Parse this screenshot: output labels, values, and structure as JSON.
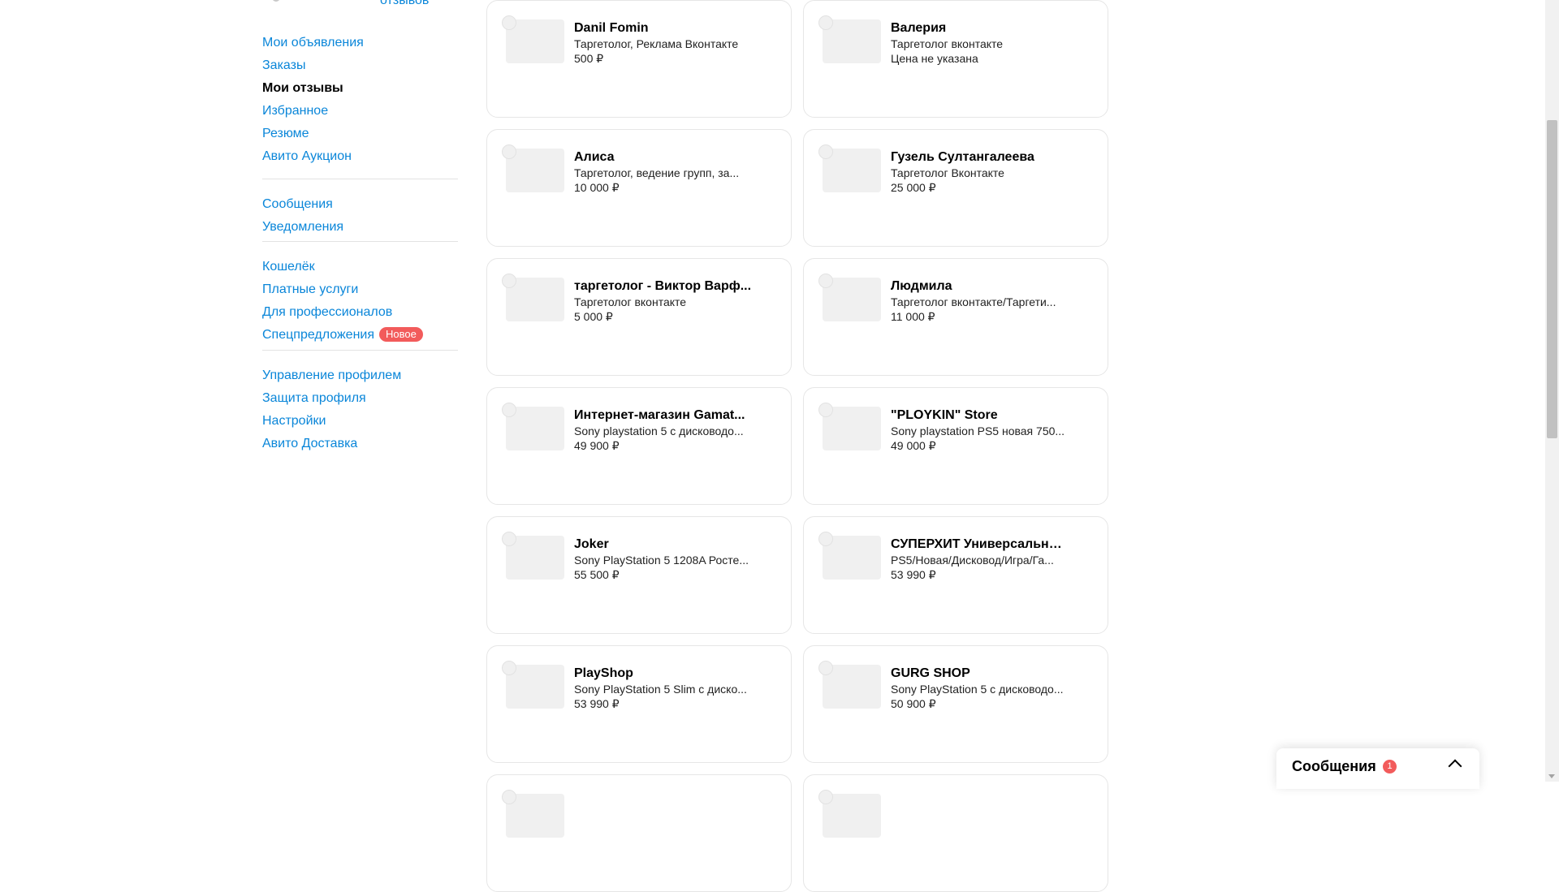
{
  "sidebar": {
    "reviews_link": "отзывов",
    "groups": [
      {
        "items": [
          {
            "label": "Мои объявления",
            "name": "sidebar-item-my-ads"
          },
          {
            "label": "Заказы",
            "name": "sidebar-item-orders"
          },
          {
            "label": "Мои отзывы",
            "name": "sidebar-item-my-reviews",
            "active": true
          },
          {
            "label": "Избранное",
            "name": "sidebar-item-favorites"
          },
          {
            "label": "Резюме",
            "name": "sidebar-item-resume"
          },
          {
            "label": "Авито Аукцион",
            "name": "sidebar-item-auction"
          }
        ]
      },
      {
        "items": [
          {
            "label": "Сообщения",
            "name": "sidebar-item-messages"
          },
          {
            "label": "Уведомления",
            "name": "sidebar-item-notifications"
          }
        ]
      },
      {
        "items": [
          {
            "label": "Кошелёк",
            "name": "sidebar-item-wallet"
          },
          {
            "label": "Платные услуги",
            "name": "sidebar-item-paid-services"
          },
          {
            "label": "Для профессионалов",
            "name": "sidebar-item-for-pros"
          },
          {
            "label": "Спецпредложения",
            "name": "sidebar-item-special-offers",
            "badge": "Новое"
          }
        ]
      },
      {
        "items": [
          {
            "label": "Управление профилем",
            "name": "sidebar-item-profile-management"
          },
          {
            "label": "Защита профиля",
            "name": "sidebar-item-profile-security"
          },
          {
            "label": "Настройки",
            "name": "sidebar-item-settings"
          },
          {
            "label": "Авито Доставка",
            "name": "sidebar-item-delivery"
          }
        ]
      }
    ]
  },
  "cards": [
    {
      "name": "Danil Fomin",
      "desc": "Таргетолог, Реклама Вконтакте",
      "price": "500 ₽"
    },
    {
      "name": "Валерия",
      "desc": "Таргетолог вконтакте",
      "price": "Цена не указана"
    },
    {
      "name": "Алиса",
      "desc": "Таргетолог, ведение групп, за...",
      "price": "10 000 ₽"
    },
    {
      "name": "Гузель Султангалеева",
      "desc": "Таргетолог Вконтакте",
      "price": "25 000 ₽"
    },
    {
      "name": "таргетолог - Виктор Варф...",
      "desc": "Таргетолог вконтакте",
      "price": "5 000 ₽"
    },
    {
      "name": "Людмила",
      "desc": "Таргетолог вконтакте/Таргети...",
      "price": "11 000 ₽"
    },
    {
      "name": "Интернет-магазин Gamat...",
      "desc": "Sony playstation 5 с дисководо...",
      "price": "49 900 ₽"
    },
    {
      "name": "\"PLOYKIN\" Store",
      "desc": "Sony playstation PS5 новая 750...",
      "price": "49 000 ₽"
    },
    {
      "name": "Joker",
      "desc": "Sony PlayStation 5 1208A Росте...",
      "price": "55 500 ₽"
    },
    {
      "name": "СУПЕРХИТ Универсальны...",
      "desc": "PS5/Новая/Дисковод/Игра/Га...",
      "price": "53 990 ₽"
    },
    {
      "name": "PlayShop",
      "desc": "Sony PlayStation 5 Slim с диско...",
      "price": "53 990 ₽"
    },
    {
      "name": "GURG SHOP",
      "desc": "Sony PlayStation 5 с дисководо...",
      "price": "50 900 ₽"
    },
    {
      "name": "",
      "desc": "",
      "price": ""
    },
    {
      "name": "",
      "desc": "",
      "price": ""
    }
  ],
  "messages_widget": {
    "title": "Сообщения",
    "count": "1"
  }
}
